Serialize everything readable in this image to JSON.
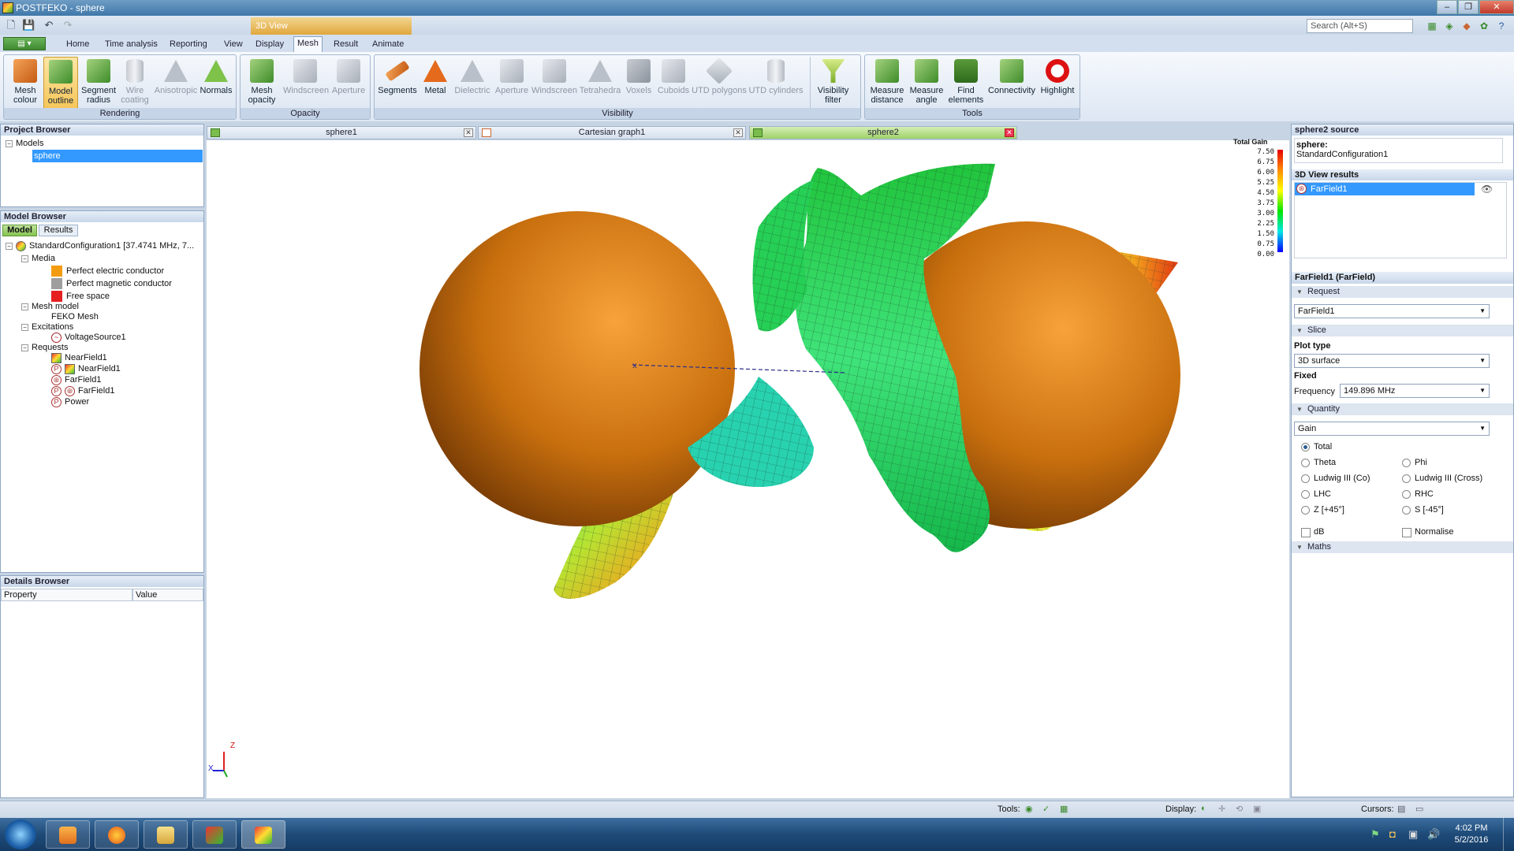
{
  "window": {
    "title": "POSTFEKO - sphere",
    "context_tab": "3D View",
    "search_placeholder": "Search (Alt+S)"
  },
  "file_button": "▤ ▾",
  "menu_tabs": [
    "Home",
    "Time analysis",
    "Reporting",
    "View",
    "Display",
    "Mesh",
    "Result",
    "Animate"
  ],
  "active_menu_tab": "Mesh",
  "ribbon": {
    "groups": [
      {
        "label": "Rendering",
        "buttons": [
          {
            "label": "Mesh colour",
            "sub": "▾",
            "icon": "mesh-colour-icon"
          },
          {
            "label": "Model outline",
            "sub": "▾",
            "icon": "model-outline-icon"
          },
          {
            "label": "Segment radius",
            "sub": "▾",
            "icon": "segment-radius-icon"
          },
          {
            "label": "Wire coating",
            "icon": "wire-coating-icon"
          },
          {
            "label": "Anisotropic",
            "icon": "anisotropic-icon"
          },
          {
            "label": "Normals",
            "icon": "normals-icon"
          }
        ]
      },
      {
        "label": "Opacity",
        "buttons": [
          {
            "label": "Mesh opacity",
            "icon": "mesh-opacity-icon"
          },
          {
            "label": "Windscreen",
            "icon": "windscreen-icon"
          },
          {
            "label": "Aperture",
            "icon": "aperture-icon"
          }
        ]
      },
      {
        "label": "Visibility",
        "buttons": [
          {
            "label": "Segments",
            "icon": "segments-icon"
          },
          {
            "label": "Metal",
            "icon": "metal-icon"
          },
          {
            "label": "Dielectric",
            "icon": "dielectric-icon"
          },
          {
            "label": "Aperture",
            "icon": "aperture-icon"
          },
          {
            "label": "Windscreen",
            "icon": "windscreen-icon"
          },
          {
            "label": "Tetrahedra",
            "icon": "tetrahedra-icon"
          },
          {
            "label": "Voxels",
            "icon": "voxels-icon"
          },
          {
            "label": "Cuboids",
            "icon": "cuboids-icon"
          },
          {
            "label": "UTD polygons",
            "icon": "utd-polygons-icon"
          },
          {
            "label": "UTD cylinders",
            "icon": "utd-cylinders-icon"
          },
          {
            "label": "Visibility filter",
            "icon": "visibility-filter-icon"
          }
        ]
      },
      {
        "label": "Tools",
        "buttons": [
          {
            "label": "Measure distance",
            "icon": "measure-distance-icon"
          },
          {
            "label": "Measure angle",
            "icon": "measure-angle-icon"
          },
          {
            "label": "Find elements",
            "icon": "find-elements-icon"
          },
          {
            "label": "Connectivity",
            "icon": "connectivity-icon"
          },
          {
            "label": "Highlight",
            "icon": "highlight-icon"
          }
        ]
      }
    ]
  },
  "project_browser": {
    "title": "Project Browser",
    "root": "Models",
    "selected": "sphere"
  },
  "model_browser": {
    "title": "Model Browser",
    "tabs": [
      "Model",
      "Results"
    ],
    "config": "StandardConfiguration1 [37.4741 MHz, 7...",
    "media_label": "Media",
    "media": [
      {
        "name": "Perfect electric conductor",
        "color": "#f39c12"
      },
      {
        "name": "Perfect magnetic conductor",
        "color": "#9e9e9e"
      },
      {
        "name": "Free space",
        "color": "#e62020"
      }
    ],
    "mesh_model_label": "Mesh model",
    "mesh": "FEKO Mesh",
    "excitations_label": "Excitations",
    "excitation": "VoltageSource1",
    "requests_label": "Requests",
    "requests": [
      "NearField1",
      "NearField1",
      "FarField1",
      "FarField1",
      "Power"
    ]
  },
  "details_browser": {
    "title": "Details Browser",
    "columns": [
      "Property",
      "Value"
    ]
  },
  "doc_tabs": [
    "sphere1",
    "Cartesian graph1",
    "sphere2"
  ],
  "active_doc_tab": "sphere2",
  "legend": {
    "title": "Total Gain",
    "values": [
      "7.50",
      "6.75",
      "6.00",
      "5.25",
      "4.50",
      "3.75",
      "3.00",
      "2.25",
      "1.50",
      "0.75",
      "0.00"
    ]
  },
  "axes": {
    "z": "Z",
    "x": "X"
  },
  "right_panel": {
    "source_title": "sphere2 source",
    "source_name": "sphere:",
    "source_config": "StandardConfiguration1",
    "results_title": "3D View results",
    "result_item": "FarField1",
    "props_title": "FarField1 (FarField)",
    "request_section": "Request",
    "request_value": "FarField1",
    "slice_section": "Slice",
    "plot_type_label": "Plot type",
    "plot_type_value": "3D surface",
    "fixed_label": "Fixed",
    "frequency_label": "Frequency",
    "frequency_value": "149.896 MHz",
    "quantity_section": "Quantity",
    "quantity_value": "Gain",
    "radios": [
      "Total",
      "Theta",
      "Phi",
      "Ludwig III (Co)",
      "Ludwig III (Cross)",
      "LHC",
      "RHC",
      "Z [+45°]",
      "S [-45°]"
    ],
    "selected_radio": "Total",
    "checks": [
      "dB",
      "Normalise"
    ],
    "maths_section": "Maths"
  },
  "status": {
    "tools_label": "Tools:",
    "display_label": "Display:",
    "cursors_label": "Cursors:"
  },
  "taskbar": {
    "time": "4:02 PM",
    "date": "5/2/2016"
  }
}
